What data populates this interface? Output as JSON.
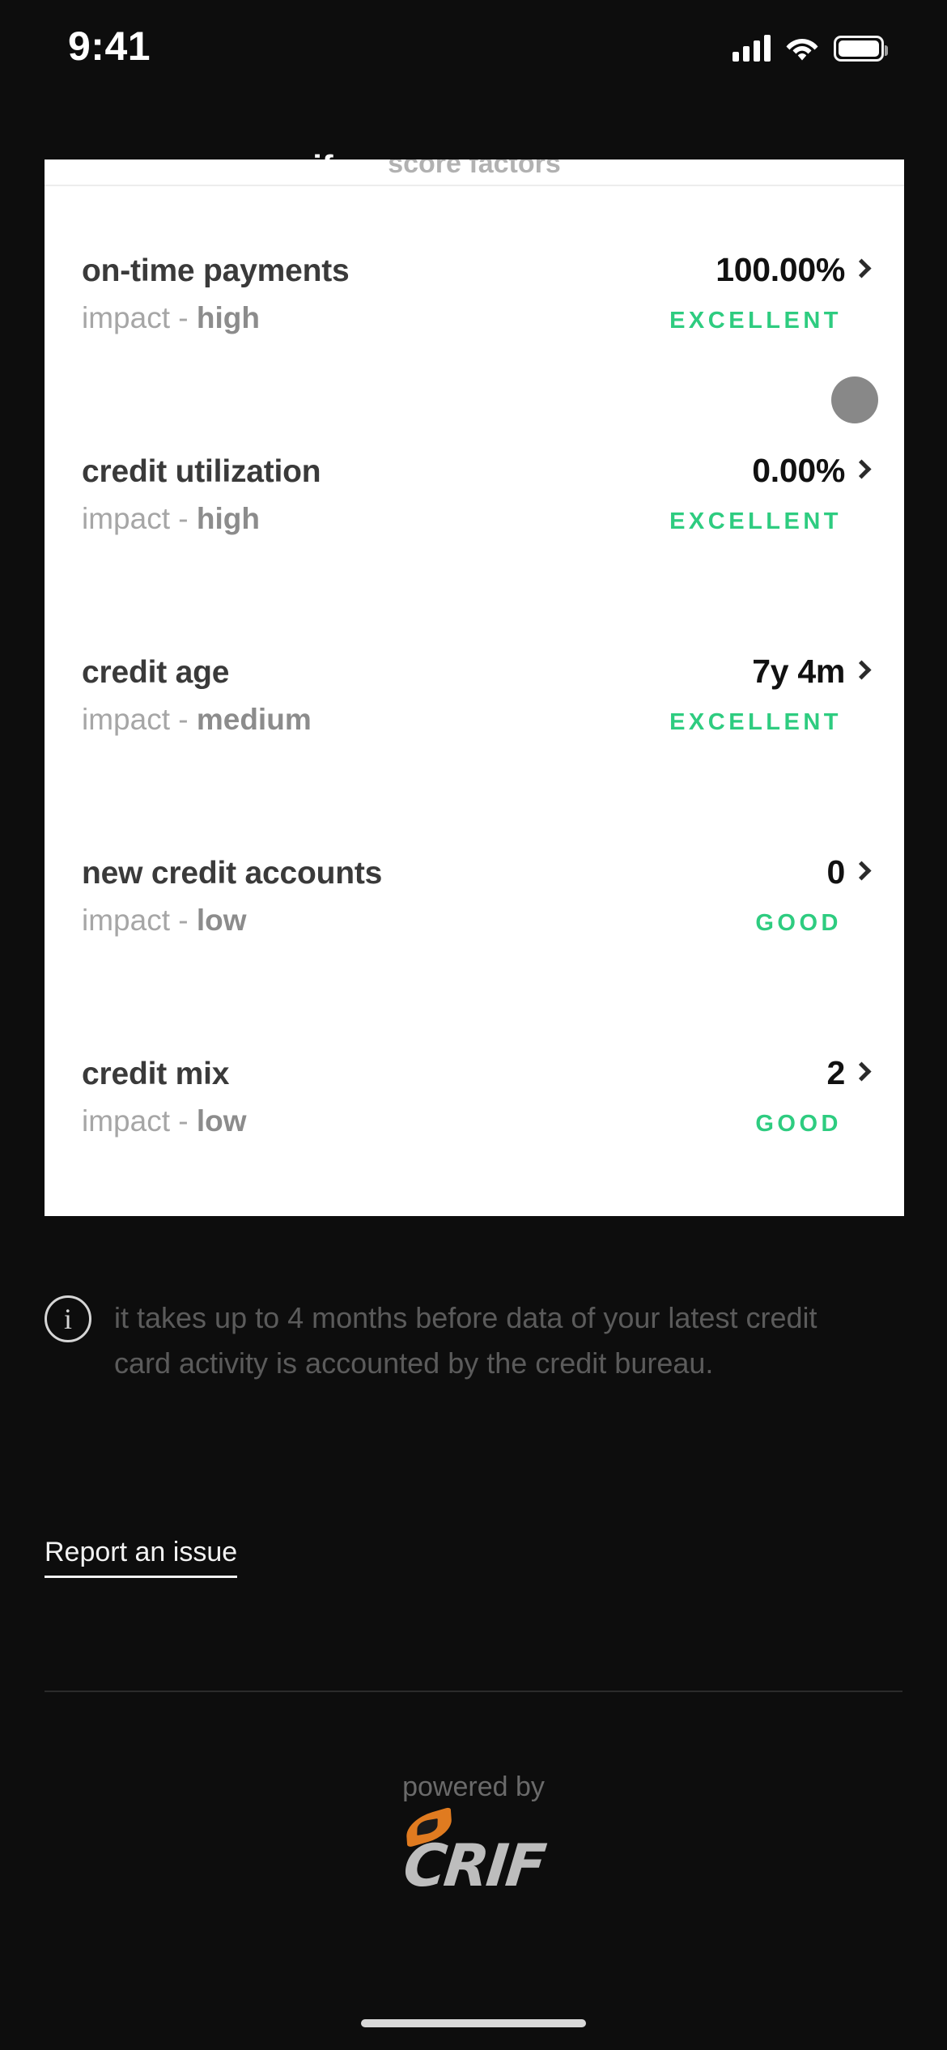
{
  "status_bar": {
    "time": "9:41",
    "signal_icon": "cellular-signal-icon",
    "wifi_icon": "wifi-icon",
    "battery_icon": "battery-icon"
  },
  "header": {
    "back_icon": "back-arrow-icon",
    "title": "your crif score"
  },
  "card": {
    "peek_text": "score factors",
    "factors": [
      {
        "name": "on-time payments",
        "impact_label": "impact - ",
        "impact_level": "high",
        "value": "100.00%",
        "rating": "EXCELLENT",
        "rating_color": "#2ecc80"
      },
      {
        "name": "credit utilization",
        "impact_label": "impact - ",
        "impact_level": "high",
        "value": "0.00%",
        "rating": "EXCELLENT",
        "rating_color": "#2ecc80"
      },
      {
        "name": "credit age",
        "impact_label": "impact - ",
        "impact_level": "medium",
        "value": "7y 4m",
        "rating": "EXCELLENT",
        "rating_color": "#2ecc80"
      },
      {
        "name": "new credit accounts",
        "impact_label": "impact - ",
        "impact_level": "low",
        "value": "0",
        "rating": "GOOD",
        "rating_color": "#2ecc80"
      },
      {
        "name": "credit mix",
        "impact_label": "impact - ",
        "impact_level": "low",
        "value": "2",
        "rating": "GOOD",
        "rating_color": "#2ecc80"
      }
    ]
  },
  "info_note": {
    "icon": "info-circle-icon",
    "icon_glyph": "i",
    "text": "it takes up to 4 months before data of your latest credit card activity is accounted by the credit bureau."
  },
  "report": {
    "link_label": "Report an issue"
  },
  "footer": {
    "powered_by": "powered by",
    "brand": "CRIF",
    "brand_logo_icon": "crif-logo-icon"
  }
}
